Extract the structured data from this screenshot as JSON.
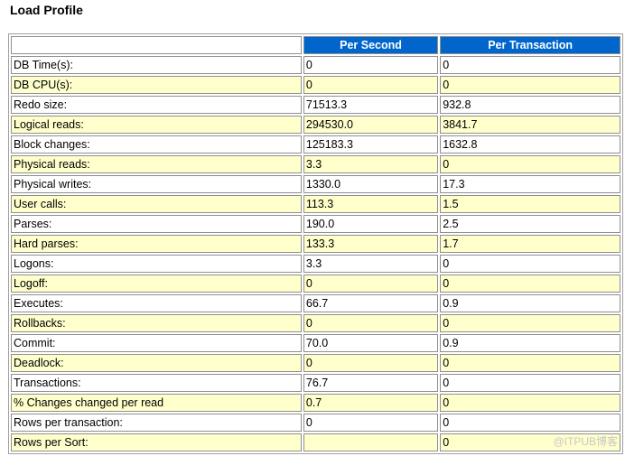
{
  "page": {
    "title": "Load Profile",
    "watermark": "@ITPUB博客"
  },
  "table": {
    "headers": [
      "",
      "Per Second",
      "Per Transaction"
    ],
    "rows": [
      {
        "label": "DB Time(s):",
        "per_second": "0",
        "per_transaction": "0"
      },
      {
        "label": "DB CPU(s):",
        "per_second": "0",
        "per_transaction": "0"
      },
      {
        "label": "Redo size:",
        "per_second": "71513.3",
        "per_transaction": "932.8"
      },
      {
        "label": "Logical reads:",
        "per_second": "294530.0",
        "per_transaction": "3841.7"
      },
      {
        "label": "Block changes:",
        "per_second": "125183.3",
        "per_transaction": "1632.8"
      },
      {
        "label": "Physical reads:",
        "per_second": "3.3",
        "per_transaction": "0"
      },
      {
        "label": "Physical writes:",
        "per_second": "1330.0",
        "per_transaction": "17.3"
      },
      {
        "label": "User calls:",
        "per_second": "113.3",
        "per_transaction": "1.5"
      },
      {
        "label": "Parses:",
        "per_second": "190.0",
        "per_transaction": "2.5"
      },
      {
        "label": "Hard parses:",
        "per_second": "133.3",
        "per_transaction": "1.7"
      },
      {
        "label": "Logons:",
        "per_second": "3.3",
        "per_transaction": "0"
      },
      {
        "label": "Logoff:",
        "per_second": "0",
        "per_transaction": "0"
      },
      {
        "label": "Executes:",
        "per_second": "66.7",
        "per_transaction": "0.9"
      },
      {
        "label": "Rollbacks:",
        "per_second": "0",
        "per_transaction": "0"
      },
      {
        "label": "Commit:",
        "per_second": "70.0",
        "per_transaction": "0.9"
      },
      {
        "label": "Deadlock:",
        "per_second": "0",
        "per_transaction": "0"
      },
      {
        "label": "Transactions:",
        "per_second": "76.7",
        "per_transaction": "0"
      },
      {
        "label": "% Changes changed per read",
        "per_second": "0.7",
        "per_transaction": "0"
      },
      {
        "label": "Rows per transaction:",
        "per_second": "0",
        "per_transaction": "0"
      },
      {
        "label": "Rows per Sort:",
        "per_second": "",
        "per_transaction": "0"
      }
    ]
  },
  "colors": {
    "header_bg": "#0066cc",
    "header_text": "#ffffff",
    "row_alt_bg": "#ffffcc",
    "row_bg": "#ffffff"
  }
}
